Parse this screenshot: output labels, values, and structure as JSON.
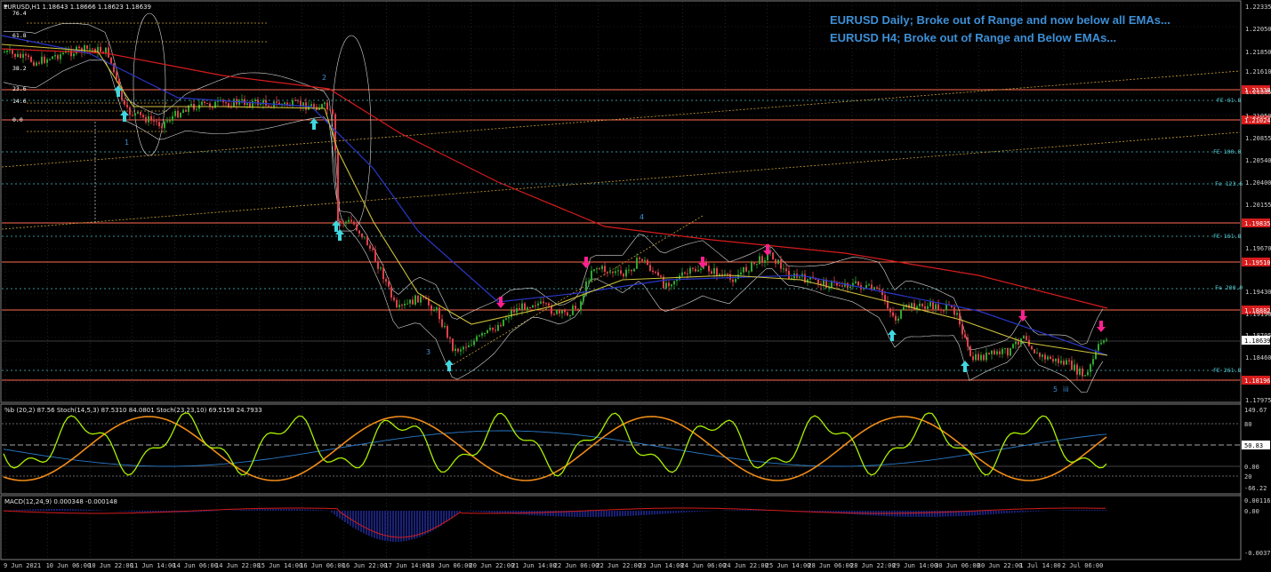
{
  "main_header": "EURUSD,H1  1.18643 1.18666 1.18623 1.18639",
  "annotation": {
    "line1": "EURUSD Daily; Broke out of Range and now below all EMAs...",
    "line2": "EURUSD H4; Broke out of Range and Below EMAs..."
  },
  "colors": {
    "background": "#000000",
    "grid": "#3a3a3a",
    "bull_candle": "#2ea82e",
    "bear_candle": "#e0404a",
    "ema_red": "#d61c1c",
    "ema_blue": "#2a37c8",
    "ema_yellow": "#cfc23a",
    "envelope": "#d8d8d8",
    "level_line": "#ff6a50",
    "annotation_text": "#3d8fd6",
    "buy_arrow": "#40d8e0",
    "sell_arrow": "#ff2090",
    "stoch_fast": "#a8f000",
    "stoch_slow": "#f08c18",
    "macd_signal": "#d61c1c",
    "macd_hist": "#2a37c8"
  },
  "price_axis": {
    "ticks": [
      "1.22335",
      "1.22050",
      "1.21850",
      "1.21610",
      "1.21335",
      "1.21050",
      "1.20855",
      "1.20540",
      "1.20400",
      "1.20155",
      "1.19670",
      "1.19430",
      "1.19190",
      "1.18705",
      "1.18460",
      "1.17975"
    ],
    "current_price": "1.18639",
    "red_level_labels": [
      "1.21338",
      "1.21024",
      "1.19835",
      "1.19510",
      "1.18882",
      "1.18196"
    ]
  },
  "fib_labels_left": [
    "76.4",
    "61.8",
    "38.2",
    "23.6",
    "14.6",
    "0.0"
  ],
  "fib_ext_labels": [
    "FE 61.8",
    "FE 100.0",
    "Fe 123.6",
    "FE 161.8",
    "Fe 200.0",
    "FE 261.8"
  ],
  "wave_labels": [
    "1",
    "2",
    "3",
    "4",
    "5",
    "iii"
  ],
  "time_axis": [
    "9 Jun 2021",
    "10 Jun 06:00",
    "10 Jun 22:00",
    "11 Jun 14:00",
    "14 Jun 06:00",
    "14 Jun 22:00",
    "15 Jun 14:00",
    "16 Jun 06:00",
    "16 Jun 22:00",
    "17 Jun 14:00",
    "18 Jun 06:00",
    "20 Jun 22:00",
    "21 Jun 14:00",
    "22 Jun 06:00",
    "22 Jun 22:00",
    "23 Jun 14:00",
    "24 Jun 06:00",
    "24 Jun 22:00",
    "25 Jun 14:00",
    "28 Jun 06:00",
    "28 Jun 22:00",
    "29 Jun 14:00",
    "30 Jun 06:00",
    "30 Jun 22:00",
    "1 Jul 14:00",
    "2 Jul 06:00"
  ],
  "stoch_panel": {
    "header": "%b (20,2) 87.56  Stoch(14,5,3) 87.5310 84.0801  Stoch(23,23,10) 69.5158 24.7933",
    "scale": [
      "149.67",
      "50.83",
      "0.00",
      "-66.22"
    ],
    "levels": [
      "80",
      "20"
    ]
  },
  "macd_panel": {
    "header": "MACD(12,24,9) 0.000348 -0.000148",
    "scale": [
      "0.001169",
      "0.00",
      "-0.003762"
    ]
  }
}
